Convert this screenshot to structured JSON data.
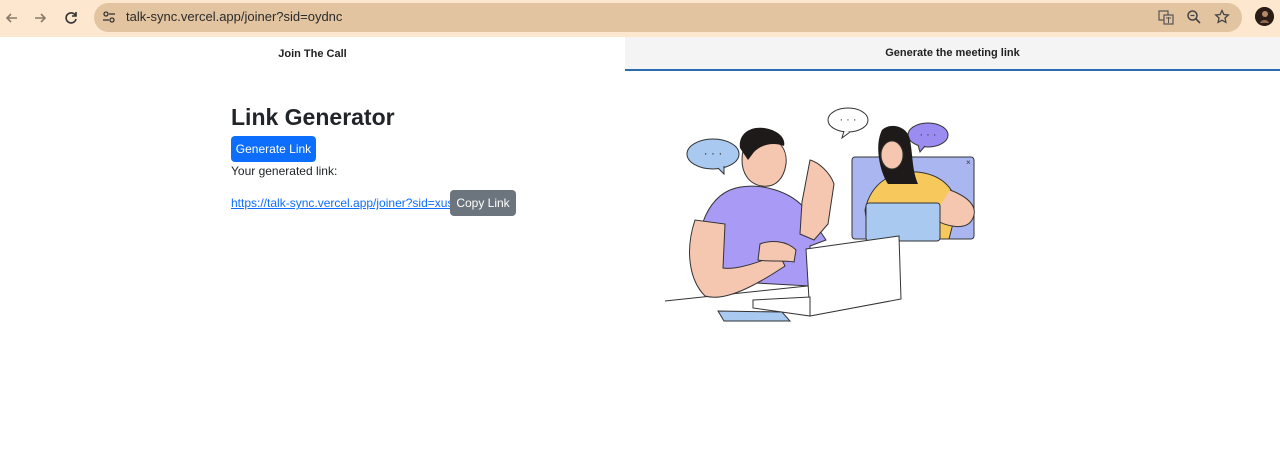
{
  "browser": {
    "url": "talk-sync.vercel.app/joiner?sid=oydnc",
    "icons": [
      "back-arrow-icon",
      "forward-arrow-icon",
      "reload-icon",
      "site-settings-icon",
      "translate-icon",
      "zoom-icon",
      "bookmark-star-icon",
      "profile-avatar"
    ]
  },
  "tabs": [
    {
      "label": "Join The Call",
      "active": false
    },
    {
      "label": "Generate the meeting link",
      "active": true
    }
  ],
  "main": {
    "title": "Link Generator",
    "generate_label": "Generate Link",
    "generated_label": "Your generated link:",
    "link": "https://talk-sync.vercel.app/joiner?sid=xussc",
    "copy_label": "Copy Link"
  },
  "colors": {
    "browser_bar": "#fde7cf",
    "omnibox": "#e3c4a0",
    "primary": "#0d6efd",
    "secondary": "#6c757d",
    "active_tab_underline": "#2b6cb0"
  }
}
